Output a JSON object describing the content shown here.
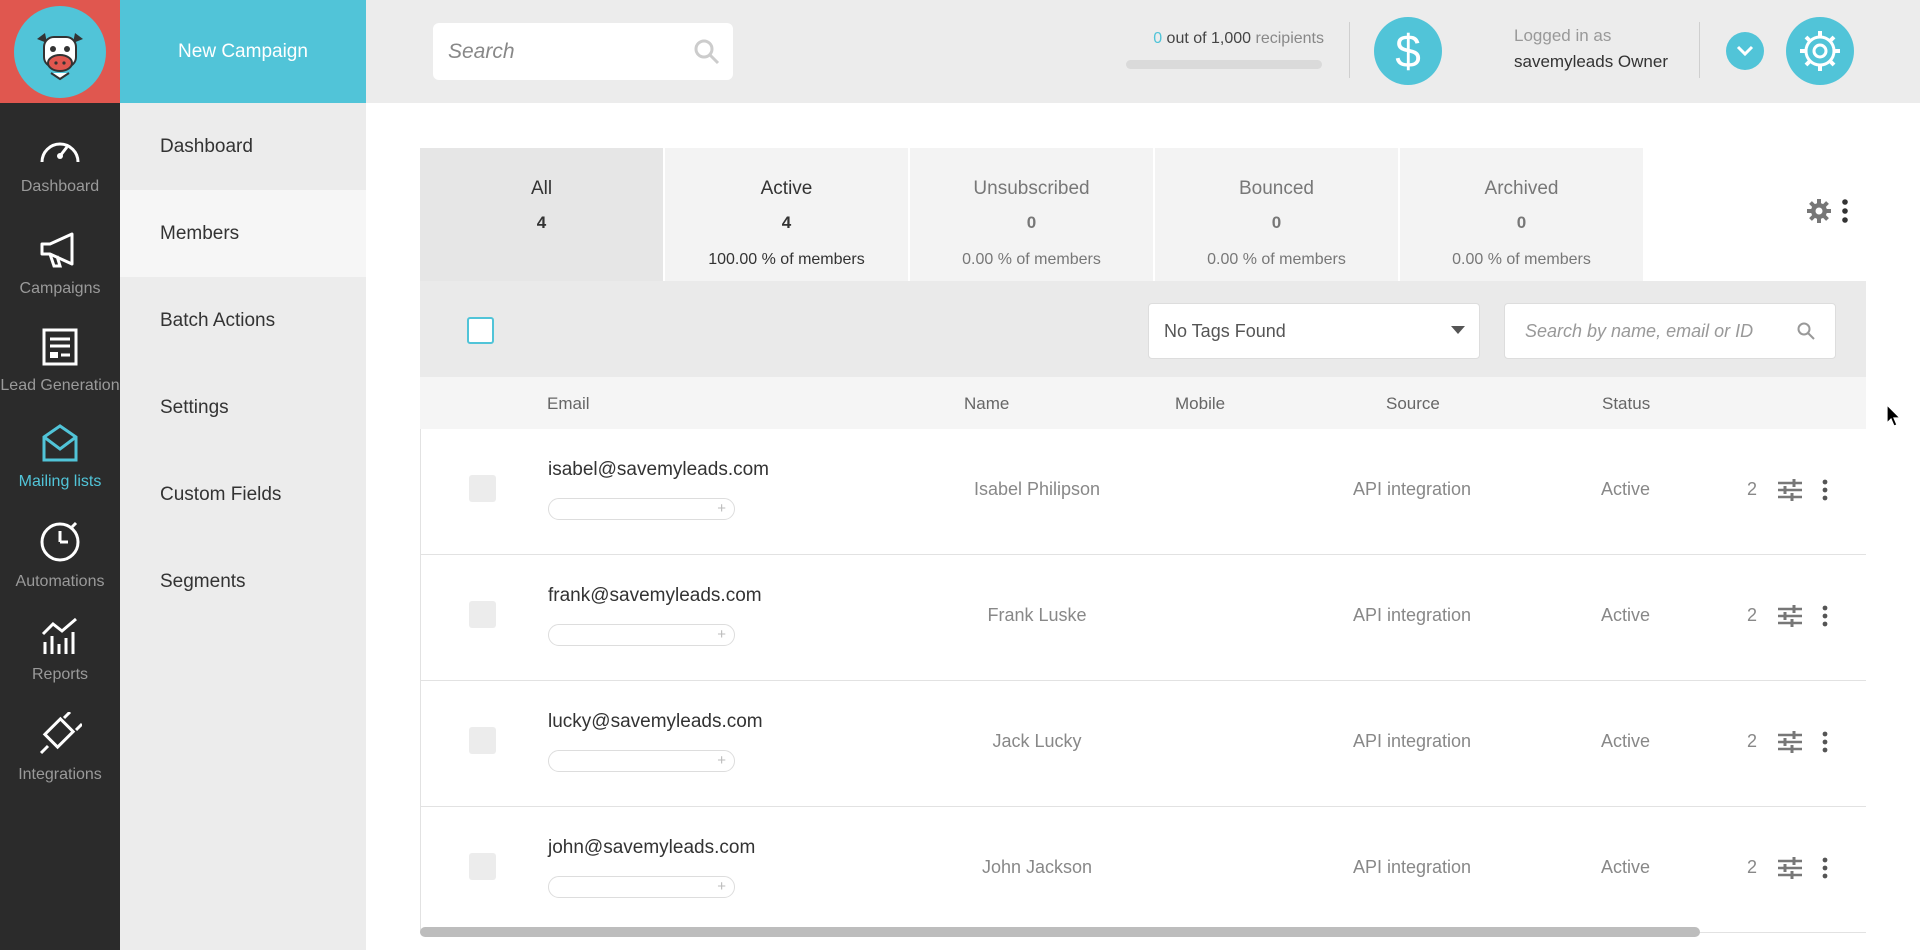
{
  "rail": {
    "logo_icon": "cow-mascot-icon",
    "items": [
      {
        "label": "Dashboard",
        "icon": "speedometer-icon"
      },
      {
        "label": "Campaigns",
        "icon": "megaphone-icon"
      },
      {
        "label": "Lead Generation",
        "icon": "form-icon"
      },
      {
        "label": "Mailing lists",
        "icon": "mail-icon",
        "active": true
      },
      {
        "label": "Automations",
        "icon": "stopwatch-icon"
      },
      {
        "label": "Reports",
        "icon": "reports-chart-icon"
      },
      {
        "label": "Integrations",
        "icon": "plug-icon"
      }
    ]
  },
  "sidebar": {
    "new_campaign": "New Campaign",
    "items": [
      {
        "label": "Dashboard"
      },
      {
        "label": "Members",
        "active": true
      },
      {
        "label": "Batch Actions"
      },
      {
        "label": "Settings"
      },
      {
        "label": "Custom Fields"
      },
      {
        "label": "Segments"
      }
    ]
  },
  "header": {
    "search_placeholder": "Search",
    "recipients_count": "0",
    "recipients_mid": "out of 1,000",
    "recipients_word": "recipients",
    "logged_in_label": "Logged in as",
    "logged_in_user": "savemyleads Owner",
    "dollar_symbol": "$"
  },
  "tabs": [
    {
      "name": "All",
      "count": "4",
      "pct": ""
    },
    {
      "name": "Active",
      "count": "4",
      "pct": "100.00 % of members"
    },
    {
      "name": "Unsubscribed",
      "count": "0",
      "pct": "0.00 % of members"
    },
    {
      "name": "Bounced",
      "count": "0",
      "pct": "0.00 % of members"
    },
    {
      "name": "Archived",
      "count": "0",
      "pct": "0.00 % of members"
    }
  ],
  "filter": {
    "tags_select": "No Tags Found",
    "search_placeholder": "Search by name, email or ID"
  },
  "table": {
    "columns": {
      "email": "Email",
      "name": "Name",
      "mobile": "Mobile",
      "source": "Source",
      "status": "Status"
    },
    "rows": [
      {
        "email": "isabel@savemyleads.com",
        "name": "Isabel Philipson",
        "mobile": "",
        "source": "API integration",
        "status": "Active",
        "count": "2"
      },
      {
        "email": "frank@savemyleads.com",
        "name": "Frank Luske",
        "mobile": "",
        "source": "API integration",
        "status": "Active",
        "count": "2"
      },
      {
        "email": "lucky@savemyleads.com",
        "name": "Jack Lucky",
        "mobile": "",
        "source": "API integration",
        "status": "Active",
        "count": "2"
      },
      {
        "email": "john@savemyleads.com",
        "name": "John Jackson",
        "mobile": "",
        "source": "API integration",
        "status": "Active",
        "count": "2"
      }
    ],
    "tag_add_symbol": "+"
  },
  "colors": {
    "accent": "#51c4d8",
    "logo_bg": "#e0574f",
    "rail_bg": "#2b2b2b"
  }
}
